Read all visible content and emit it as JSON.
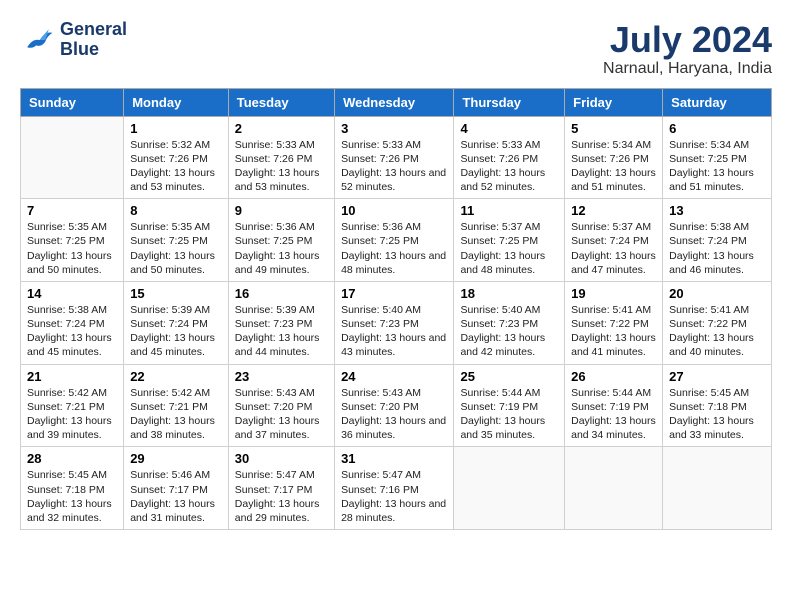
{
  "header": {
    "logo_line1": "General",
    "logo_line2": "Blue",
    "title": "July 2024",
    "subtitle": "Narnaul, Haryana, India"
  },
  "columns": [
    "Sunday",
    "Monday",
    "Tuesday",
    "Wednesday",
    "Thursday",
    "Friday",
    "Saturday"
  ],
  "weeks": [
    [
      {
        "day": "",
        "sunrise": "",
        "sunset": "",
        "daylight": ""
      },
      {
        "day": "1",
        "sunrise": "5:32 AM",
        "sunset": "7:26 PM",
        "daylight": "13 hours and 53 minutes."
      },
      {
        "day": "2",
        "sunrise": "5:33 AM",
        "sunset": "7:26 PM",
        "daylight": "13 hours and 53 minutes."
      },
      {
        "day": "3",
        "sunrise": "5:33 AM",
        "sunset": "7:26 PM",
        "daylight": "13 hours and 52 minutes."
      },
      {
        "day": "4",
        "sunrise": "5:33 AM",
        "sunset": "7:26 PM",
        "daylight": "13 hours and 52 minutes."
      },
      {
        "day": "5",
        "sunrise": "5:34 AM",
        "sunset": "7:26 PM",
        "daylight": "13 hours and 51 minutes."
      },
      {
        "day": "6",
        "sunrise": "5:34 AM",
        "sunset": "7:25 PM",
        "daylight": "13 hours and 51 minutes."
      }
    ],
    [
      {
        "day": "7",
        "sunrise": "5:35 AM",
        "sunset": "7:25 PM",
        "daylight": "13 hours and 50 minutes."
      },
      {
        "day": "8",
        "sunrise": "5:35 AM",
        "sunset": "7:25 PM",
        "daylight": "13 hours and 50 minutes."
      },
      {
        "day": "9",
        "sunrise": "5:36 AM",
        "sunset": "7:25 PM",
        "daylight": "13 hours and 49 minutes."
      },
      {
        "day": "10",
        "sunrise": "5:36 AM",
        "sunset": "7:25 PM",
        "daylight": "13 hours and 48 minutes."
      },
      {
        "day": "11",
        "sunrise": "5:37 AM",
        "sunset": "7:25 PM",
        "daylight": "13 hours and 48 minutes."
      },
      {
        "day": "12",
        "sunrise": "5:37 AM",
        "sunset": "7:24 PM",
        "daylight": "13 hours and 47 minutes."
      },
      {
        "day": "13",
        "sunrise": "5:38 AM",
        "sunset": "7:24 PM",
        "daylight": "13 hours and 46 minutes."
      }
    ],
    [
      {
        "day": "14",
        "sunrise": "5:38 AM",
        "sunset": "7:24 PM",
        "daylight": "13 hours and 45 minutes."
      },
      {
        "day": "15",
        "sunrise": "5:39 AM",
        "sunset": "7:24 PM",
        "daylight": "13 hours and 45 minutes."
      },
      {
        "day": "16",
        "sunrise": "5:39 AM",
        "sunset": "7:23 PM",
        "daylight": "13 hours and 44 minutes."
      },
      {
        "day": "17",
        "sunrise": "5:40 AM",
        "sunset": "7:23 PM",
        "daylight": "13 hours and 43 minutes."
      },
      {
        "day": "18",
        "sunrise": "5:40 AM",
        "sunset": "7:23 PM",
        "daylight": "13 hours and 42 minutes."
      },
      {
        "day": "19",
        "sunrise": "5:41 AM",
        "sunset": "7:22 PM",
        "daylight": "13 hours and 41 minutes."
      },
      {
        "day": "20",
        "sunrise": "5:41 AM",
        "sunset": "7:22 PM",
        "daylight": "13 hours and 40 minutes."
      }
    ],
    [
      {
        "day": "21",
        "sunrise": "5:42 AM",
        "sunset": "7:21 PM",
        "daylight": "13 hours and 39 minutes."
      },
      {
        "day": "22",
        "sunrise": "5:42 AM",
        "sunset": "7:21 PM",
        "daylight": "13 hours and 38 minutes."
      },
      {
        "day": "23",
        "sunrise": "5:43 AM",
        "sunset": "7:20 PM",
        "daylight": "13 hours and 37 minutes."
      },
      {
        "day": "24",
        "sunrise": "5:43 AM",
        "sunset": "7:20 PM",
        "daylight": "13 hours and 36 minutes."
      },
      {
        "day": "25",
        "sunrise": "5:44 AM",
        "sunset": "7:19 PM",
        "daylight": "13 hours and 35 minutes."
      },
      {
        "day": "26",
        "sunrise": "5:44 AM",
        "sunset": "7:19 PM",
        "daylight": "13 hours and 34 minutes."
      },
      {
        "day": "27",
        "sunrise": "5:45 AM",
        "sunset": "7:18 PM",
        "daylight": "13 hours and 33 minutes."
      }
    ],
    [
      {
        "day": "28",
        "sunrise": "5:45 AM",
        "sunset": "7:18 PM",
        "daylight": "13 hours and 32 minutes."
      },
      {
        "day": "29",
        "sunrise": "5:46 AM",
        "sunset": "7:17 PM",
        "daylight": "13 hours and 31 minutes."
      },
      {
        "day": "30",
        "sunrise": "5:47 AM",
        "sunset": "7:17 PM",
        "daylight": "13 hours and 29 minutes."
      },
      {
        "day": "31",
        "sunrise": "5:47 AM",
        "sunset": "7:16 PM",
        "daylight": "13 hours and 28 minutes."
      },
      {
        "day": "",
        "sunrise": "",
        "sunset": "",
        "daylight": ""
      },
      {
        "day": "",
        "sunrise": "",
        "sunset": "",
        "daylight": ""
      },
      {
        "day": "",
        "sunrise": "",
        "sunset": "",
        "daylight": ""
      }
    ]
  ]
}
